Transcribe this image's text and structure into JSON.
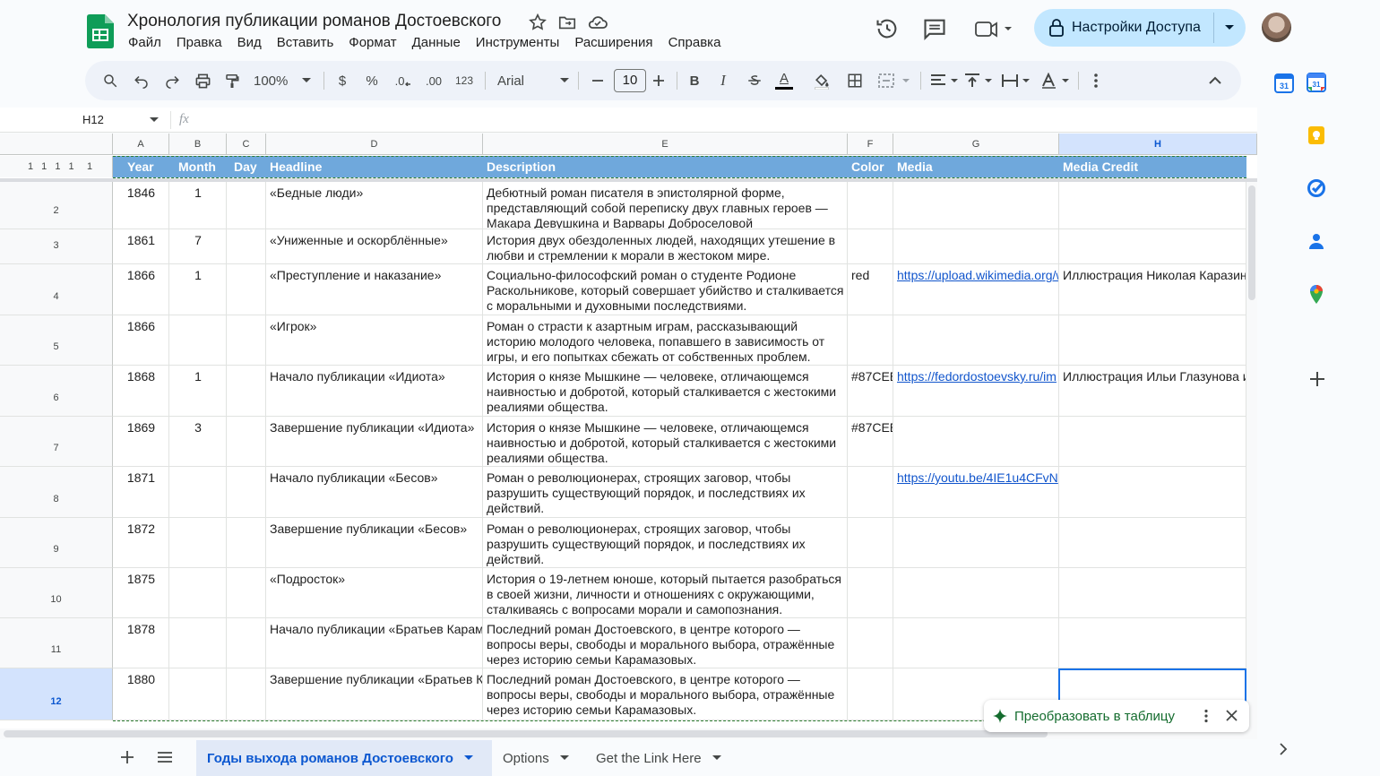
{
  "app": {
    "title": "Хронология публикации романов Достоевского",
    "menu": [
      "Файл",
      "Правка",
      "Вид",
      "Вставить",
      "Формат",
      "Данные",
      "Инструменты",
      "Расширения",
      "Справка"
    ],
    "share_label": "Настройки Доступа"
  },
  "toolbar": {
    "zoom": "100%",
    "currency": "$",
    "percent": "%",
    "dec_less": ".0",
    "dec_more": ".00",
    "number_format": "123",
    "font": "Arial",
    "font_size": "10",
    "bold": "B",
    "italic": "I",
    "text_color": "A"
  },
  "formula_bar": {
    "name_box": "H12",
    "fx": "fx"
  },
  "grid": {
    "columns": [
      "A",
      "B",
      "C",
      "D",
      "E",
      "F",
      "G",
      "H"
    ],
    "selected_column": "H",
    "group_levels": "1 1 1 1",
    "header": {
      "row": "1",
      "cells": [
        "Year",
        "Month",
        "Day",
        "Headline",
        "Description",
        "Color",
        "Media",
        "Media Credit"
      ]
    },
    "rows": [
      {
        "num": "2",
        "year": "1846",
        "month": "1",
        "day": "",
        "headline": "«Бедные люди»",
        "description": "Дебютный роман писателя в эпистолярной форме, представляющий собой переписку двух главных героев — Макара Девушкина и Варвары Доброселовой",
        "color": "",
        "media": "",
        "credit": ""
      },
      {
        "num": "3",
        "year": "1861",
        "month": "7",
        "day": "",
        "headline": "«Униженные и оскорблённые»",
        "description": "История двух обездоленных людей, находящих утешение в любви и стремлении к морали в жестоком мире.",
        "color": "",
        "media": "",
        "credit": ""
      },
      {
        "num": "4",
        "year": "1866",
        "month": "1",
        "day": "",
        "headline": "«Преступление и наказание»",
        "description": "Социально-философский роман о студенте Родионе Раскольникове, который совершает убийство и сталкивается с моральными и духовными последствиями.",
        "color": "red",
        "media": "https://upload.wikimedia.org/w",
        "credit": "Иллюстрация Николая Каразин"
      },
      {
        "num": "5",
        "year": "1866",
        "month": "",
        "day": "",
        "headline": "«Игрок»",
        "description": "Роман о страсти к азартным играм, рассказывающий историю молодого человека, попавшего в зависимость от игры, и его попытках сбежать от собственных проблем.",
        "color": "",
        "media": "",
        "credit": ""
      },
      {
        "num": "6",
        "year": "1868",
        "month": "1",
        "day": "",
        "headline": "Начало публикации «Идиота»",
        "description": "История о князе Мышкине — человеке, отличающемся наивностью и добротой, который сталкивается с жестокими реалиями общества.",
        "color": "#87CEE",
        "media": "https://fedordostoevsky.ru/im",
        "credit": "Иллюстрация Ильи Глазунова и"
      },
      {
        "num": "7",
        "year": "1869",
        "month": "3",
        "day": "",
        "headline": "Завершение публикации «Идиота»",
        "description": "История о князе Мышкине — человеке, отличающемся наивностью и добротой, который сталкивается с жестокими реалиями общества.",
        "color": "#87CEE",
        "media": "",
        "credit": ""
      },
      {
        "num": "8",
        "year": "1871",
        "month": "",
        "day": "",
        "headline": "Начало публикации «Бесов»",
        "description": "Роман о революционерах, строящих заговор, чтобы разрушить существующий порядок, и последствиях их действий.",
        "color": "",
        "media": "https://youtu.be/4IE1u4CFvN",
        "credit": ""
      },
      {
        "num": "9",
        "year": "1872",
        "month": "",
        "day": "",
        "headline": "Завершение публикации «Бесов»",
        "description": "Роман о революционерах, строящих заговор, чтобы разрушить существующий порядок, и последствиях их действий.",
        "color": "",
        "media": "",
        "credit": ""
      },
      {
        "num": "10",
        "year": "1875",
        "month": "",
        "day": "",
        "headline": "«Подросток»",
        "description": "История о 19-летнем юноше, который пытается разобраться в своей жизни, личности и отношениях с окружающими, сталкиваясь с вопросами морали и самопознания.",
        "color": "",
        "media": "",
        "credit": ""
      },
      {
        "num": "11",
        "year": "1878",
        "month": "",
        "day": "",
        "headline": "Начало публикации «Братьев Карам",
        "description": "Последний роман Достоевского, в центре которого — вопросы веры, свободы и морального выбора, отражённые через историю семьи Карамазовых.",
        "color": "",
        "media": "",
        "credit": ""
      },
      {
        "num": "12",
        "year": "1880",
        "month": "",
        "day": "",
        "headline": "Завершение публикации «Братьев К",
        "description": "Последний роман Достоевского, в центре которого — вопросы веры, свободы и морального выбора, отражённые через историю семьи Карамазовых.",
        "color": "",
        "media": "",
        "credit": ""
      }
    ]
  },
  "toast": {
    "label": "Преобразовать в таблицу"
  },
  "sheets": [
    {
      "label": "Годы выхода романов Достоевского",
      "active": true
    },
    {
      "label": "Options",
      "active": false
    },
    {
      "label": "Get the Link Here",
      "active": false
    }
  ],
  "colors": {
    "header_fill": "#6fa8dc",
    "accent": "#0b57d0",
    "share_bg": "#c2e7ff",
    "link": "#1155cc"
  }
}
